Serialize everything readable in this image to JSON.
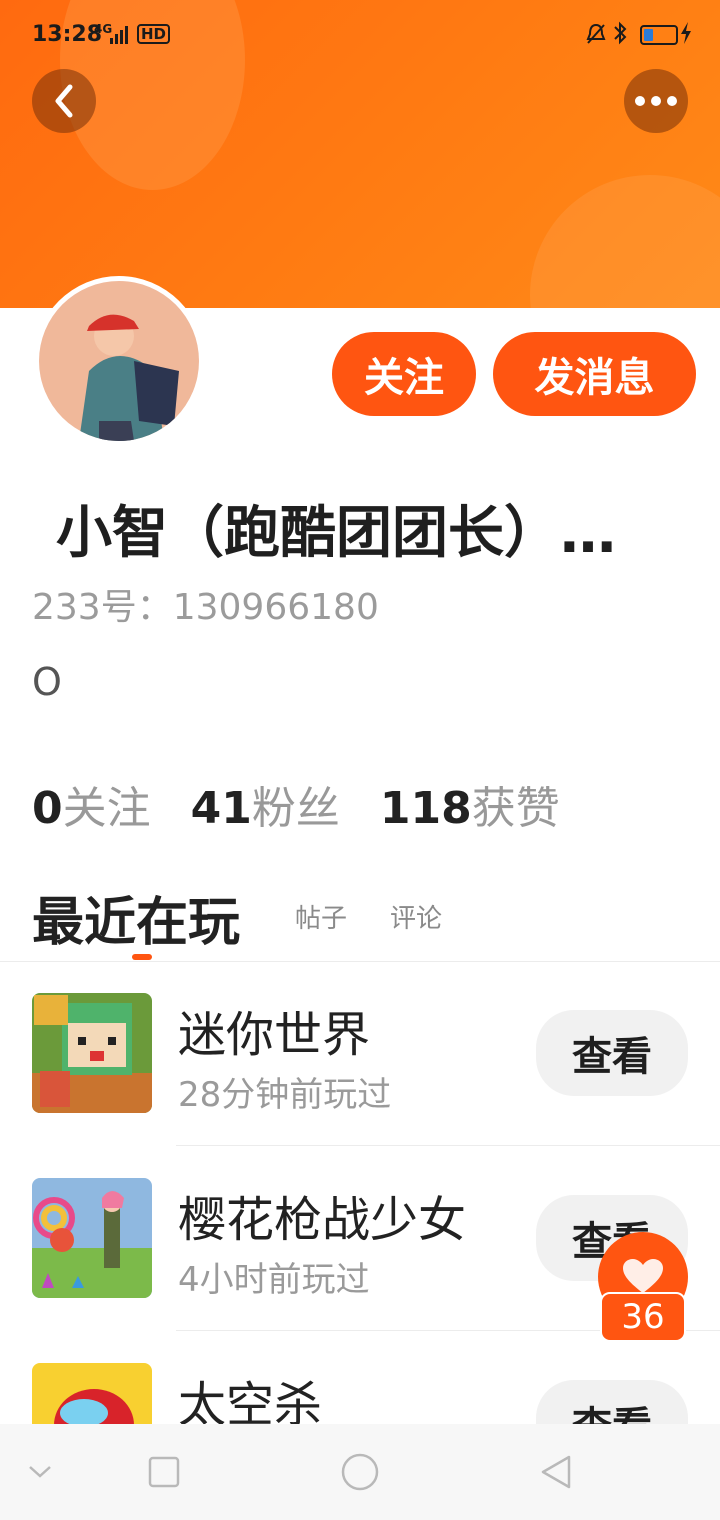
{
  "status_bar": {
    "time": "13:28",
    "network": "4G",
    "hd": "HD",
    "icons": [
      "bell-muted-icon",
      "bluetooth-icon",
      "battery-icon",
      "charging-icon"
    ]
  },
  "header": {
    "back_icon": "chevron-left-icon",
    "more_icon": "more-dots-icon",
    "banner_color": "#ff7a12"
  },
  "profile": {
    "follow_label": "关注",
    "message_label": "发消息",
    "name": "小智（跑酷团团长）…",
    "id_text": "233号：130966180",
    "signature": "O",
    "stats": [
      {
        "num": "0",
        "label": "关注"
      },
      {
        "num": "41",
        "label": "粉丝"
      },
      {
        "num": "118",
        "label": "获赞"
      }
    ]
  },
  "tabs": {
    "active": "最近在玩",
    "posts": "帖子",
    "comments": "评论"
  },
  "games": [
    {
      "title": "迷你世界",
      "subtitle": "28分钟前玩过",
      "button": "查看"
    },
    {
      "title": "樱花枪战少女",
      "subtitle": "4小时前玩过",
      "button": "查看"
    },
    {
      "title": "太空杀",
      "subtitle": "",
      "button": "查看"
    }
  ],
  "like_float": {
    "icon": "heart-icon",
    "count": "36"
  },
  "accent_color": "#ff5511",
  "nav": [
    "chevron-down-icon",
    "square-icon",
    "circle-icon",
    "triangle-back-icon"
  ]
}
